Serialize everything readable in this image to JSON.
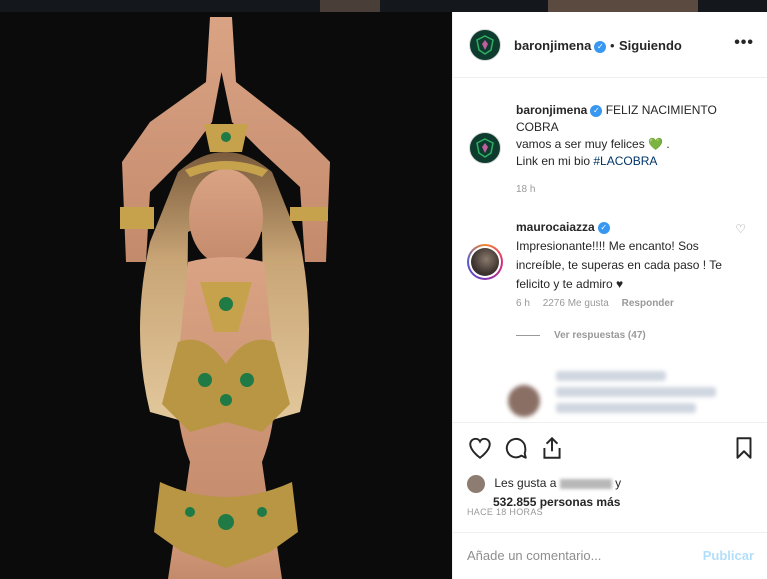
{
  "post": {
    "username": "baronjimena",
    "separator": "•",
    "following_label": "Siguiendo",
    "more_label": "•••"
  },
  "caption": {
    "username": "baronjimena",
    "line1": "FELIZ NACIMIENTO COBRA",
    "line2": "vamos a ser muy felices",
    "line2_emoji": "💚",
    "line2_end": " .",
    "line3": "Link en mi bio ",
    "hashtag": "#LACOBRA",
    "time": "18 h"
  },
  "comment": {
    "username": "maurocaiazza",
    "text": "Impresionante!!!! Me encanto! Sos increíble, te superas en cada paso ! Te felicito y te admiro ♥",
    "time": "6 h",
    "likes": "2276 Me gusta",
    "reply_label": "Responder",
    "view_replies": "Ver respuestas (47)"
  },
  "likes": {
    "prefix": "Les gusta a",
    "suffix": "y",
    "count": "532.855 personas más"
  },
  "time_label": "HACE 18 HORAS",
  "add_comment": {
    "placeholder": "Añade un comentario...",
    "publish_label": "Publicar"
  },
  "icons": {
    "heart": "heart-icon",
    "comment": "comment-icon",
    "share": "share-icon",
    "save": "bookmark-icon",
    "more": "more-options-icon",
    "verified": "verified-badge-icon"
  },
  "colors": {
    "verified_blue": "#3897f0",
    "hashtag": "#003569",
    "publish_disabled": "#b2dffc",
    "photo_bg": "#0b0b0b"
  }
}
